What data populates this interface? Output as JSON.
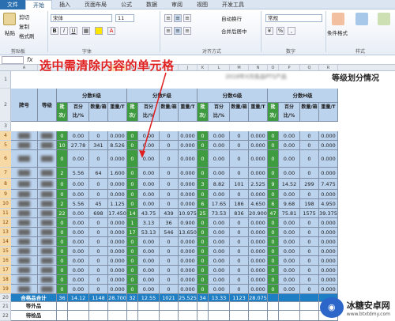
{
  "ribbon_tabs": [
    "文件",
    "开始",
    "插入",
    "页面布局",
    "公式",
    "数据",
    "审阅",
    "视图",
    "开发工具"
  ],
  "ribbon": {
    "clipboard": {
      "cut": "剪切",
      "copy": "复制",
      "format_painter": "格式刷",
      "paste": "粘贴",
      "label": "剪贴板"
    },
    "font": {
      "name": "宋体",
      "size": "11",
      "label": "字体",
      "bold": "B",
      "italic": "I",
      "underline": "U"
    },
    "alignment": {
      "wrap": "自动换行",
      "merge": "合并后居中",
      "label": "对齐方式"
    },
    "number": {
      "format": "常规",
      "label": "数字"
    },
    "styles": {
      "conditional": "条件格式",
      "table": "套用\n表格格式",
      "cell": "单元格样式",
      "label": "样式"
    }
  },
  "annotation": "选中需清除内容的单元格",
  "title": "等级划分情况",
  "header": {
    "brand": "牌号",
    "grade": "等级",
    "groups": [
      "分数E级",
      "分数F级",
      "分数G级",
      "分数H级"
    ],
    "subcols": [
      "批次/批",
      "百分比/%",
      "数量/箱",
      "重量/T"
    ]
  },
  "col_letters": [
    "A",
    "B",
    "C",
    "D",
    "E",
    "F",
    "G",
    "H",
    "I",
    "J",
    "K",
    "L",
    "M",
    "N",
    "O",
    "P",
    "Q",
    "R"
  ],
  "row_numbers": [
    "1",
    "2",
    "3",
    "4",
    "5",
    "6",
    "7",
    "8",
    "9",
    "10",
    "11",
    "12",
    "13",
    "14",
    "15",
    "16",
    "17",
    "18",
    "19",
    "20",
    "21",
    "22"
  ],
  "rows": [
    [
      "",
      "",
      "0",
      "0.00",
      "0",
      "0.000",
      "0",
      "0.00",
      "0",
      "0.000",
      "0",
      "0.00",
      "0",
      "0.000",
      "0",
      "0.00",
      "0",
      "0.000"
    ],
    [
      "",
      "",
      "10",
      "27.78",
      "341",
      "8.526",
      "0",
      "0.00",
      "0",
      "0.000",
      "0",
      "0.00",
      "0",
      "0.000",
      "0",
      "0.00",
      "0",
      "0.000"
    ],
    [
      "",
      "",
      "0",
      "0.00",
      "0",
      "0.000",
      "0",
      "0.00",
      "0",
      "0.000",
      "0",
      "0.00",
      "0",
      "0.000",
      "0",
      "0.00",
      "0",
      "0.000"
    ],
    [
      "",
      "",
      "2",
      "5.56",
      "64",
      "1.600",
      "0",
      "0.00",
      "0",
      "0.000",
      "0",
      "0.00",
      "0",
      "0.000",
      "0",
      "0.00",
      "0",
      "0.000"
    ],
    [
      "",
      "",
      "0",
      "0.00",
      "0",
      "0.000",
      "0",
      "0.00",
      "0",
      "0.000",
      "3",
      "8.82",
      "101",
      "2.525",
      "9",
      "14.52",
      "299",
      "7.475"
    ],
    [
      "",
      "",
      "0",
      "0.00",
      "0",
      "0.000",
      "0",
      "0.00",
      "0",
      "0.000",
      "0",
      "0.00",
      "0",
      "0.000",
      "0",
      "0.00",
      "0",
      "0.000"
    ],
    [
      "",
      "",
      "2",
      "5.56",
      "45",
      "1.125",
      "0",
      "0.00",
      "0",
      "0.000",
      "6",
      "17.65",
      "186",
      "4.650",
      "6",
      "9.68",
      "198",
      "4.950"
    ],
    [
      "",
      "",
      "22",
      "0.00",
      "698",
      "17.450",
      "14",
      "43.75",
      "439",
      "10.975",
      "25",
      "73.53",
      "836",
      "20.900",
      "47",
      "75.81",
      "1575",
      "39.375"
    ],
    [
      "",
      "",
      "0",
      "0.00",
      "0",
      "0.000",
      "1",
      "3.13",
      "36",
      "0.900",
      "0",
      "0.00",
      "0",
      "0.000",
      "0",
      "0.00",
      "0",
      "0.000"
    ],
    [
      "",
      "",
      "0",
      "0.00",
      "0",
      "0.000",
      "17",
      "53.13",
      "546",
      "13.650",
      "0",
      "0.00",
      "0",
      "0.000",
      "0",
      "0.00",
      "0",
      "0.000"
    ],
    [
      "",
      "",
      "0",
      "0.00",
      "0",
      "0.000",
      "0",
      "0.00",
      "0",
      "0.000",
      "0",
      "0.00",
      "0",
      "0.000",
      "0",
      "0.00",
      "0",
      "0.000"
    ],
    [
      "",
      "",
      "0",
      "0.00",
      "0",
      "0.000",
      "0",
      "0.00",
      "0",
      "0.000",
      "0",
      "0.00",
      "0",
      "0.000",
      "0",
      "0.00",
      "0",
      "0.000"
    ],
    [
      "",
      "",
      "0",
      "0.00",
      "0",
      "0.000",
      "0",
      "0.00",
      "0",
      "0.000",
      "0",
      "0.00",
      "0",
      "0.000",
      "0",
      "0.00",
      "0",
      "0.000"
    ],
    [
      "",
      "",
      "0",
      "0.00",
      "0",
      "0.000",
      "0",
      "0.00",
      "0",
      "0.000",
      "0",
      "0.00",
      "0",
      "0.000",
      "0",
      "0.00",
      "0",
      "0.000"
    ],
    [
      "",
      "",
      "0",
      "0.00",
      "0",
      "0.000",
      "0",
      "0.00",
      "0",
      "0.000",
      "0",
      "0.00",
      "0",
      "0.000",
      "0",
      "0.00",
      "0",
      "0.000"
    ],
    [
      "",
      "",
      "0",
      "0.00",
      "0",
      "0.000",
      "0",
      "0.00",
      "0",
      "0.000",
      "0",
      "0.00",
      "0",
      "0.000",
      "0",
      "0.00",
      "0",
      "0.000"
    ]
  ],
  "summary_rows": [
    [
      "合格品合计",
      "",
      "36",
      "14.12",
      "1148",
      "28.700",
      "32",
      "12.55",
      "1021",
      "25.525",
      "34",
      "13.33",
      "1123",
      "28.075",
      "",
      "",
      "",
      ""
    ],
    [
      "等外品",
      "",
      "",
      "",
      "",
      "",
      "",
      "",
      "",
      "",
      "",
      "",
      "",
      "",
      "",
      "",
      "",
      ""
    ],
    [
      "待检品",
      "",
      "",
      "",
      "",
      "",
      "",
      "",
      "",
      "",
      "",
      "",
      "",
      "",
      "",
      "",
      "",
      ""
    ]
  ],
  "watermark": {
    "name": "冰糖安卓网",
    "url": "www.btxtdmy.com"
  }
}
